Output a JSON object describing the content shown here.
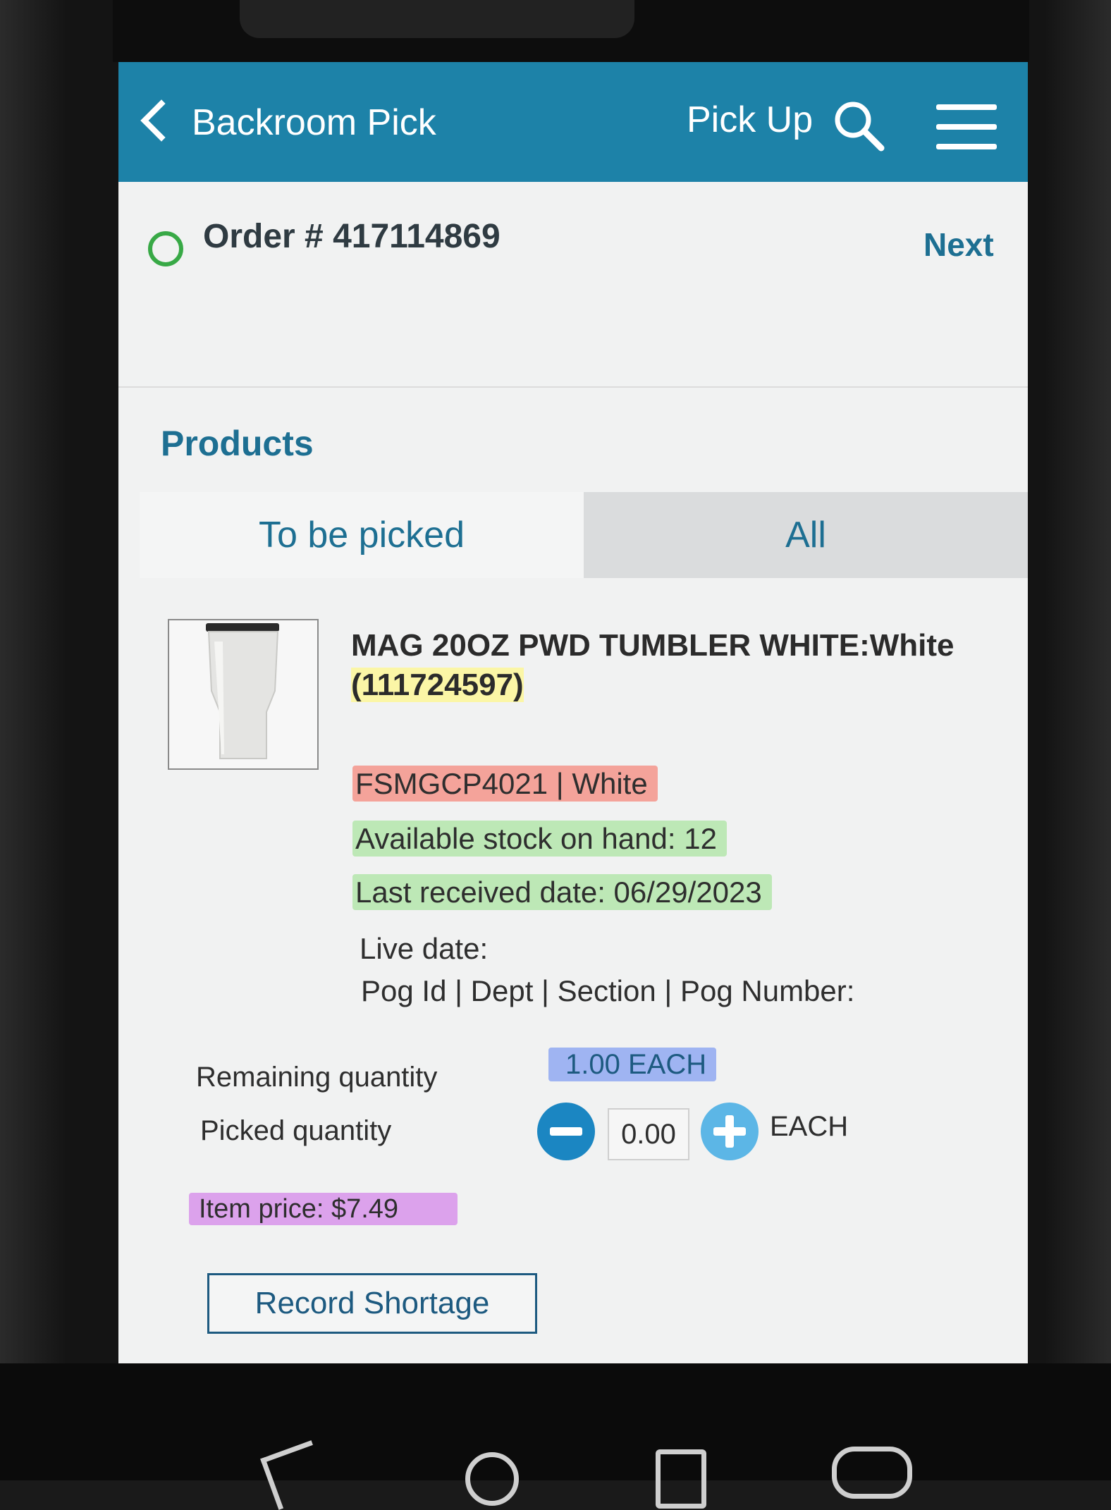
{
  "header": {
    "back_label": "Backroom Pick",
    "pickup_label": "Pick Up"
  },
  "order": {
    "number_text": "Order # 417114869",
    "next_label": "Next",
    "status_color": "#38a946"
  },
  "products": {
    "heading": "Products",
    "tabs": [
      {
        "label": "To be picked",
        "active": true
      },
      {
        "label": "All",
        "active": false
      }
    ]
  },
  "item": {
    "name": "MAG 20OZ PWD TUMBLER WHITE:White",
    "sku": "(111724597)",
    "vendor_code": "FSMGCP4021 | White",
    "available_stock": "Available stock on hand: 12",
    "last_received": "Last received date: 06/29/2023",
    "live_date": "Live date:",
    "pog_info": "Pog Id | Dept | Section | Pog Number:",
    "remaining_label": "Remaining quantity",
    "remaining_value": "1.00 EACH",
    "picked_label": "Picked quantity",
    "picked_value": "0.00",
    "picked_unit": "EACH",
    "price": "Item price: $7.49"
  },
  "actions": {
    "record_shortage_label": "Record Shortage"
  },
  "colors": {
    "header_bg": "#1d82a8",
    "accent_text": "#1d6f92",
    "highlight_yellow": "#fbf6a6",
    "highlight_red": "#f4a39a",
    "highlight_green": "#bde8b6",
    "highlight_blue": "#9fb4f2",
    "highlight_purple": "#dca2ec"
  }
}
